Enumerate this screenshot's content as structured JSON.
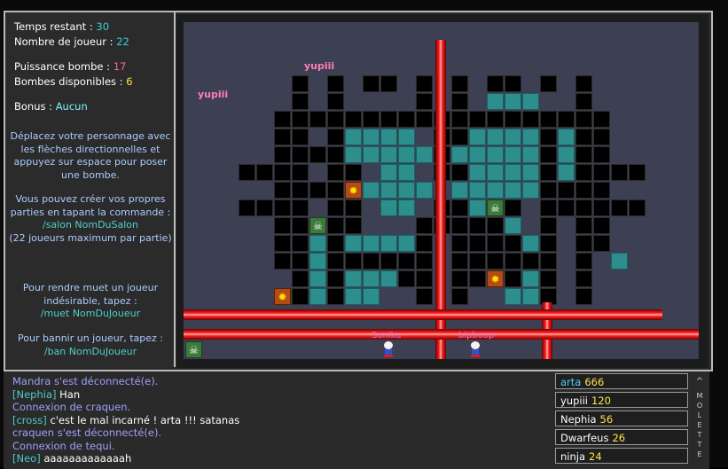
{
  "status": {
    "time_label": "Temps restant : ",
    "time_value": "30",
    "players_label": "Nombre de joueur : ",
    "players_value": "22",
    "power_label": "Puissance bombe : ",
    "power_value": "17",
    "bombs_label": "Bombes disponibles : ",
    "bombs_value": "6",
    "bonus_label": "Bonus : ",
    "bonus_value": "Aucun"
  },
  "help": {
    "move": "Déplacez votre personnage avec les flèches directionnelles et appuyez sur espace pour poser une bombe.",
    "create_intro": "Vous pouvez créer vos propres parties en tapant la commande :",
    "create_cmd": "/salon NomDuSalon",
    "create_note": "(22 joueurs maximum par partie)",
    "mute_intro": "Pour rendre muet un joueur indésirable, tapez :",
    "mute_cmd": "/muet NomDuJoueur",
    "ban_intro": "Pour bannir un joueur, tapez :",
    "ban_cmd": "/ban NomDuJoueur"
  },
  "board": {
    "floating_names": [
      "yupiii",
      "yupiii"
    ],
    "players": [
      "Soniku",
      "bipboop"
    ]
  },
  "chat": [
    {
      "type": "sys",
      "text": "Mandra s'est déconnecté(e)."
    },
    {
      "type": "msg",
      "user": "[Nephia]",
      "text": " Han"
    },
    {
      "type": "sys",
      "text": "Connexion de craquen."
    },
    {
      "type": "msg",
      "user": "[cross]",
      "text": " c'est le mal incarné ! arta !!! satanas"
    },
    {
      "type": "sys",
      "text": "craquen s'est déconnecté(e)."
    },
    {
      "type": "sys",
      "text": "Connexion de tequi."
    },
    {
      "type": "msg",
      "user": "[Neo]",
      "text": " aaaaaaaaaaaaah"
    }
  ],
  "scores": [
    {
      "name": "arta",
      "points": "666",
      "highlight": true
    },
    {
      "name": "yupiii",
      "points": "120",
      "highlight": false
    },
    {
      "name": "Nephia",
      "points": "56",
      "highlight": false
    },
    {
      "name": "Dwarfeus",
      "points": "26",
      "highlight": false
    },
    {
      "name": "ninja",
      "points": "24",
      "highlight": false
    }
  ],
  "side_tab": "MOLETTE",
  "colors": {
    "wall": "#000000",
    "soft_block": "#2d8e8e",
    "floor": "#3d3f52",
    "laser": "#ff2020"
  }
}
